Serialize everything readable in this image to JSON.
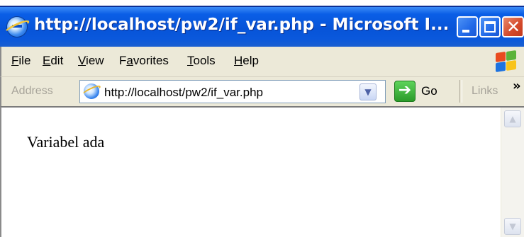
{
  "window": {
    "title": "http://localhost/pw2/if_var.php - Microsoft I...",
    "minimize_glyph": "",
    "maximize_glyph": "",
    "close_glyph": "✕"
  },
  "menu": {
    "items": [
      {
        "label": "File",
        "underline": "F"
      },
      {
        "label": "Edit",
        "underline": "E"
      },
      {
        "label": "View",
        "underline": "V"
      },
      {
        "label": "Favorites",
        "underline": "a"
      },
      {
        "label": "Tools",
        "underline": "T"
      },
      {
        "label": "Help",
        "underline": "H"
      }
    ]
  },
  "address_bar": {
    "label": "Address",
    "url": "http://localhost/pw2/if_var.php",
    "dropdown_glyph": "▼",
    "go_arrow": "➔",
    "go_label": "Go",
    "links_label": "Links",
    "links_chevron": "»"
  },
  "page": {
    "text": "Variabel ada"
  },
  "scrollbar": {
    "up_glyph": "▲",
    "down_glyph": "▼"
  },
  "colors": {
    "titlebar": "#0a5ee6",
    "chrome": "#ece9d8",
    "close_button": "#d4492a",
    "go_button": "#2b9b2a"
  },
  "icons": [
    "ie-app-icon",
    "minimize-icon",
    "maximize-icon",
    "close-icon",
    "windows-logo-icon",
    "ie-page-icon",
    "dropdown-arrow-icon",
    "go-arrow-icon",
    "chevron-right-icon",
    "scroll-up-icon",
    "scroll-down-icon"
  ]
}
